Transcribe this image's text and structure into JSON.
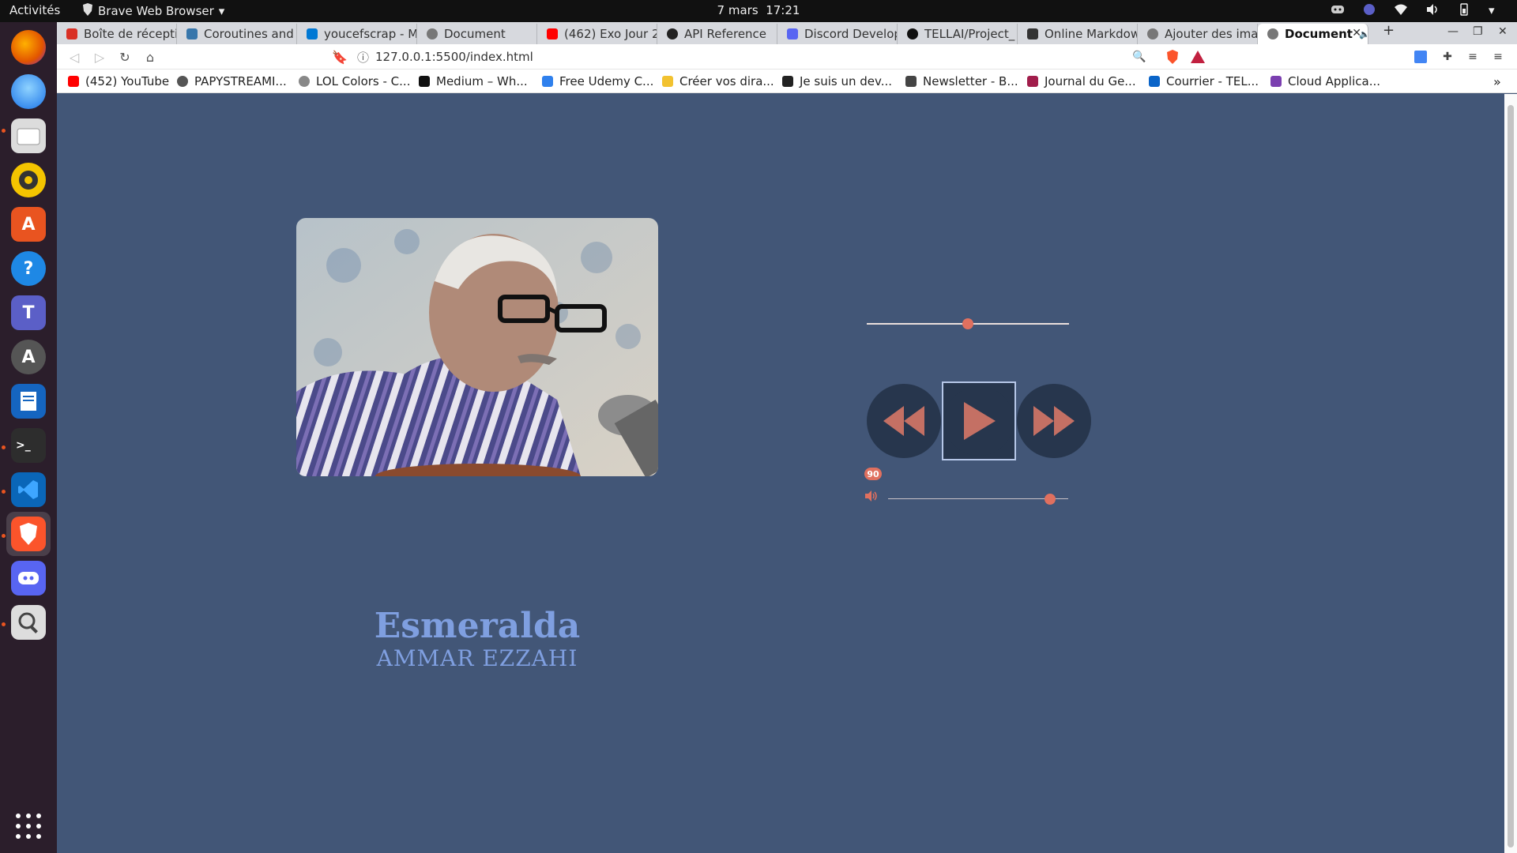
{
  "os": {
    "activities": "Activités",
    "app_name": "Brave Web Browser",
    "date": "7 mars",
    "time": "17:21"
  },
  "browser": {
    "tabs": [
      {
        "label": "Boîte de réceptio",
        "fav_color": "#d93025"
      },
      {
        "label": "Coroutines and T",
        "fav_color": "#3776ab"
      },
      {
        "label": "youcefscrap - Mic",
        "fav_color": "#0078d4"
      },
      {
        "label": "Document",
        "fav_color": "#777777"
      },
      {
        "label": "(462) Exo Jour 28",
        "fav_color": "#ff0000"
      },
      {
        "label": "API Reference",
        "fav_color": "#222222"
      },
      {
        "label": "Discord Develop",
        "fav_color": "#5865f2"
      },
      {
        "label": "TELLAI/Project_",
        "fav_color": "#111111"
      },
      {
        "label": "Online Markdow",
        "fav_color": "#333333"
      },
      {
        "label": "Ajouter des imag",
        "fav_color": "#777777"
      },
      {
        "label": "Document",
        "fav_color": "#777777",
        "active": true
      }
    ],
    "url": "127.0.0.1:5500/index.html",
    "bookmarks": [
      {
        "label": "(452) YouTube",
        "fav_color": "#ff0000"
      },
      {
        "label": "PAPYSTREAMI...",
        "fav_color": "#555555"
      },
      {
        "label": "LOL Colors - C...",
        "fav_color": "#888888"
      },
      {
        "label": "Medium – Wh...",
        "fav_color": "#111111"
      },
      {
        "label": "Free Udemy C...",
        "fav_color": "#2f80ed"
      },
      {
        "label": "Créer vos dira...",
        "fav_color": "#f2c230"
      },
      {
        "label": "Je suis un dev...",
        "fav_color": "#222222"
      },
      {
        "label": "Newsletter - B...",
        "fav_color": "#444444"
      },
      {
        "label": "Journal du Ge...",
        "fav_color": "#a11d4b"
      },
      {
        "label": "Courrier - TEL...",
        "fav_color": "#0a64c8"
      },
      {
        "label": "Cloud Applica...",
        "fav_color": "#7b3fb0"
      }
    ],
    "more_bookmarks": "»"
  },
  "player": {
    "song_title": "Esmeralda",
    "artist": "AMMAR EZZAHI",
    "progress": 0.5,
    "volume_value": "90",
    "volume": 0.9,
    "accent_color": "#e0705f",
    "bg_color": "#425677",
    "button_color": "#27364d"
  }
}
